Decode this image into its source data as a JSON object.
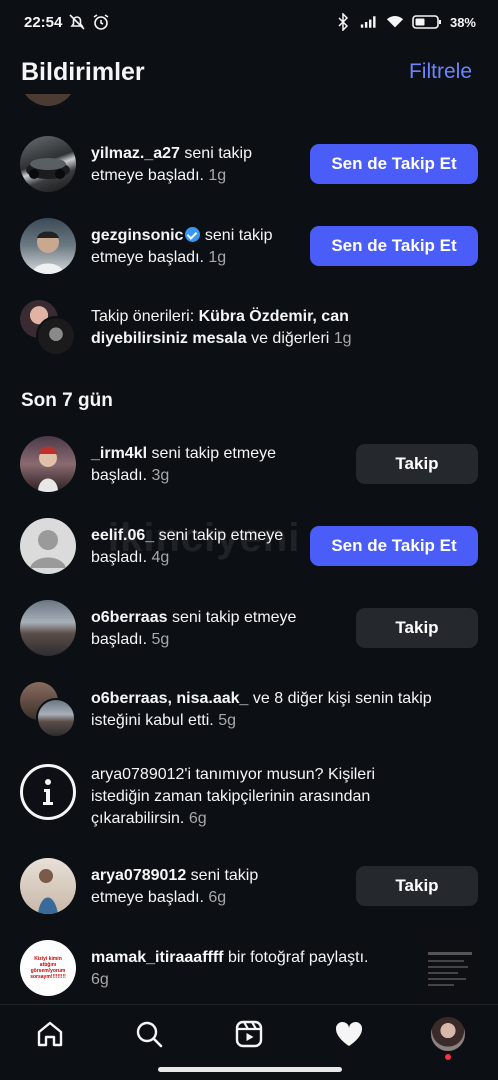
{
  "status": {
    "time": "22:54",
    "battery": "38%",
    "icons": [
      "mute-icon",
      "alarm-icon",
      "bluetooth-icon",
      "signal-icon",
      "wifi-icon",
      "battery-icon"
    ]
  },
  "header": {
    "title": "Bildirimler",
    "filter": "Filtrele"
  },
  "notifications_today": [
    {
      "username": "yilmaz._a27",
      "text": " seni takip etmeye başladı.",
      "time": "1g",
      "button": "Sen de Takip Et"
    },
    {
      "username": "gezginsonic",
      "text": " seni takip etmeye başladı.",
      "time": "1g",
      "button": "Sen de Takip Et",
      "verified": true
    },
    {
      "prefix": "Takip önerileri: ",
      "bold": "Kübra Özdemir, can diyebilirsiniz mesala",
      "text": " ve diğerleri",
      "time": "1g"
    }
  ],
  "section_7days": "Son 7 gün",
  "notifications_week": [
    {
      "username": "_irm4kl",
      "text": " seni takip etmeye başladı.",
      "time": "3g",
      "button": "Takip"
    },
    {
      "username": "eelif.06_",
      "text": " seni takip etmeye başladı.",
      "time": "4g",
      "button": "Sen de Takip Et"
    },
    {
      "username": "o6berraas",
      "text": " seni takip etmeye başladı.",
      "time": "5g",
      "button": "Takip"
    },
    {
      "username": "o6berraas, nisa.aak_",
      "text": " ve 8 diğer kişi senin takip isteğini kabul etti.",
      "time": "5g"
    },
    {
      "text": "arya0789012'i tanımıyor musun? Kişileri istediğin zaman takipçilerinin arasından çıkarabilirsin.",
      "time": "6g"
    },
    {
      "username": "arya0789012",
      "text": " seni takip etmeye başladı.",
      "time": "6g",
      "button": "Takip"
    },
    {
      "username": "mamak_itiraaaffff",
      "text": " bir fotoğraf paylaştı.",
      "time": "6g",
      "avatar_text": "Kiziyi kimin attığını görsem/yorum sorsaym!!!!!!!!!"
    }
  ],
  "watermark": "ikinciyeni",
  "colors": {
    "accent": "#4a5df9",
    "link": "#6b84ff",
    "background": "#0c1014",
    "secondary_button": "#25292e"
  },
  "nav": [
    "home-icon",
    "search-icon",
    "reels-icon",
    "heart-icon",
    "profile-avatar"
  ]
}
